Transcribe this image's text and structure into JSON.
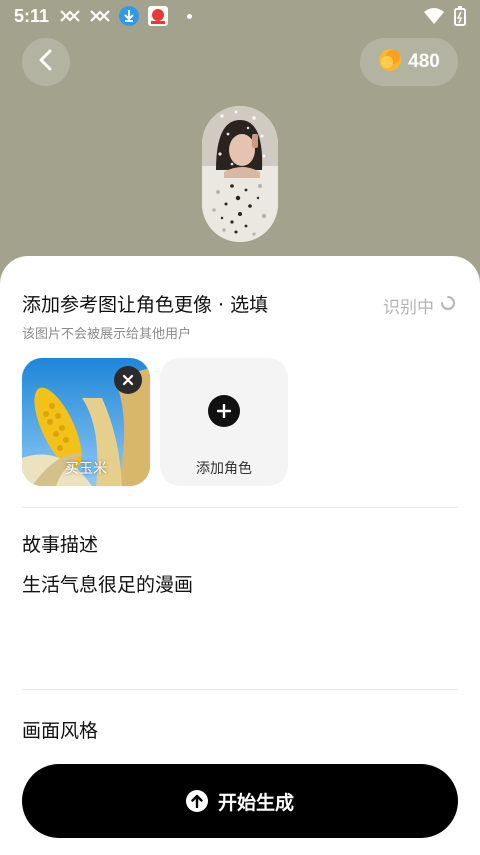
{
  "status_bar": {
    "time": "5:11",
    "icons": [
      "missed-call-icon",
      "missed-call-icon",
      "download-icon",
      "app-notification-icon",
      "dot-icon",
      "wifi-icon",
      "battery-charging-icon"
    ]
  },
  "header": {
    "back_icon": "chevron-left-icon",
    "coin_icon": "coin-icon",
    "coin_count": "480"
  },
  "reference": {
    "title": "添加参考图让角色更像 · 选填",
    "subtitle": "该图片不会被展示给其他用户",
    "status_text": "识别中",
    "images": [
      {
        "label": "买玉米"
      }
    ],
    "add_label": "添加角色"
  },
  "story": {
    "title": "故事描述",
    "text": "生活气息很足的漫画"
  },
  "style": {
    "title": "画面风格"
  },
  "action": {
    "generate_label": "开始生成"
  },
  "colors": {
    "background": "#a3a38d",
    "accent": "#000000",
    "muted_text": "#8b8b8b"
  }
}
